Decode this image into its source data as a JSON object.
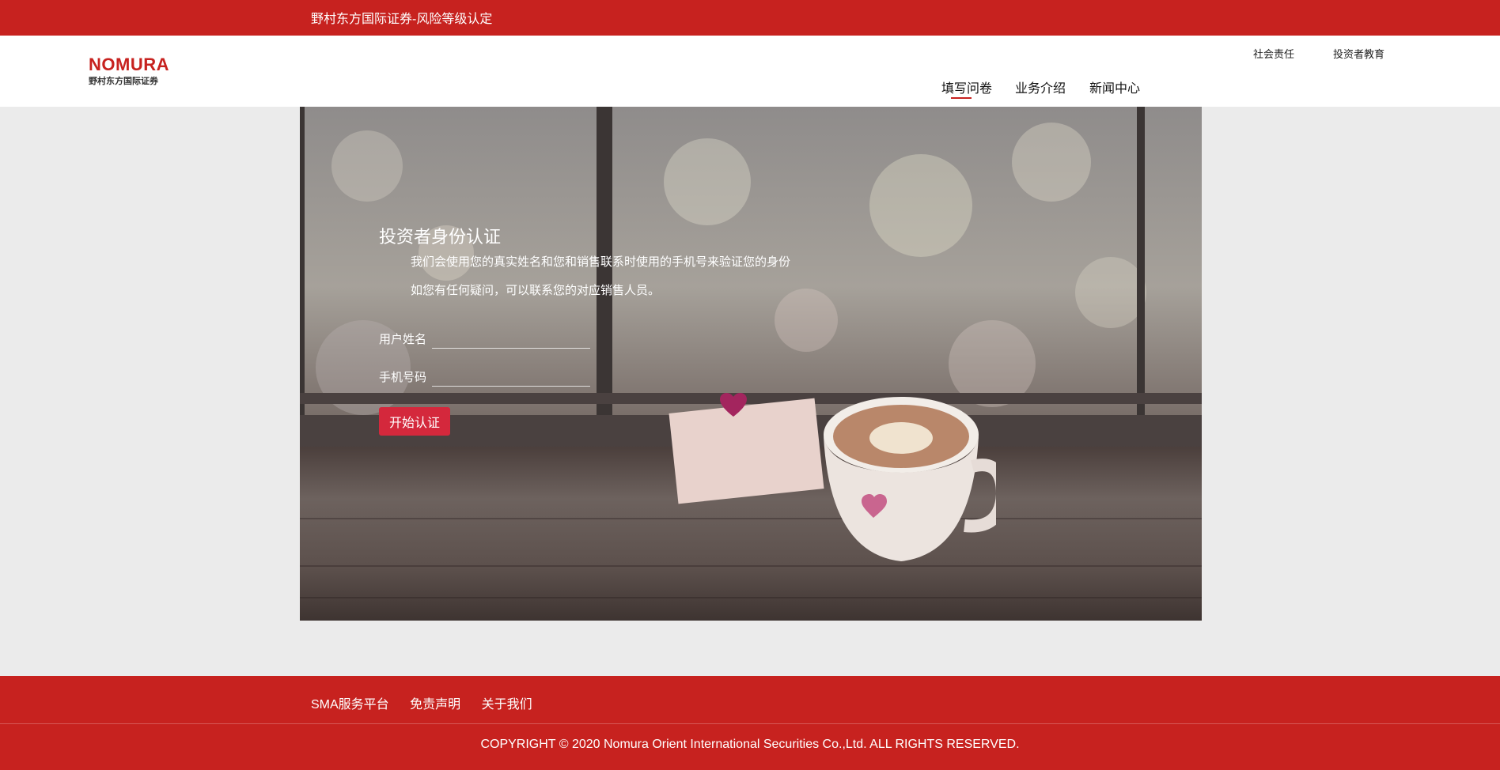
{
  "topbar": {
    "title": "野村东方国际证券-风险等级认定"
  },
  "header": {
    "logo": {
      "brand": "NOMURA",
      "sub": "野村东方国际证券"
    },
    "utility_links": [
      "社会责任",
      "投资者教育"
    ],
    "nav": [
      {
        "label": "填写问卷",
        "active": true
      },
      {
        "label": "业务介绍",
        "active": false
      },
      {
        "label": "新闻中心",
        "active": false
      }
    ]
  },
  "auth": {
    "title": "投资者身份认证",
    "desc_1": "我们会使用您的真实姓名和您和销售联系时使用的手机号来验证您的身份",
    "desc_2": "如您有任何疑问，可以联系您的对应销售人员。",
    "name_label": "用户姓名",
    "name_value": "",
    "phone_label": "手机号码",
    "phone_value": "",
    "start_button": "开始认证"
  },
  "footer": {
    "links": [
      "SMA服务平台",
      "免责声明",
      "关于我们"
    ],
    "copyright": "COPYRIGHT © 2020 Nomura Orient International Securities Co.,Ltd. ALL RIGHTS RESERVED."
  },
  "colors": {
    "brand_red": "#c7221f",
    "button_red": "#d4283c",
    "page_bg": "#ebebeb"
  },
  "icons": {
    "hero": "coffee-cup-window-photo"
  }
}
